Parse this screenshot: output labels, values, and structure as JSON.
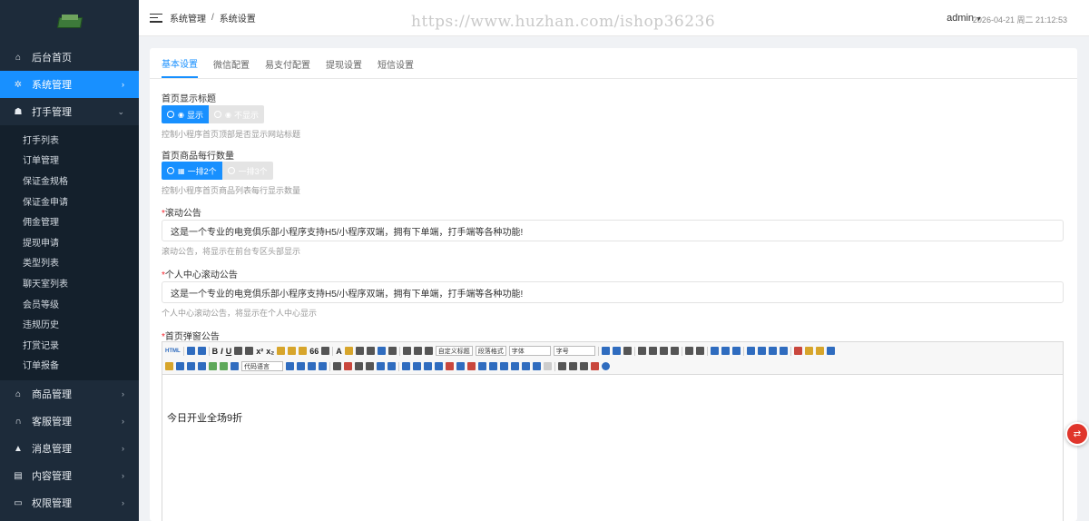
{
  "sidebar": {
    "items": [
      {
        "label": "后台首页",
        "icon": "home-icon"
      },
      {
        "label": "系统管理",
        "icon": "gear-icon",
        "active": true
      },
      {
        "label": "打手管理",
        "icon": "users-icon",
        "expanded": true
      },
      {
        "label": "商品管理",
        "icon": "bank-icon"
      },
      {
        "label": "客服管理",
        "icon": "headset-icon"
      },
      {
        "label": "消息管理",
        "icon": "bell-icon"
      },
      {
        "label": "内容管理",
        "icon": "file-icon"
      },
      {
        "label": "权限管理",
        "icon": "monitor-icon"
      }
    ],
    "sub_items": [
      "打手列表",
      "订单管理",
      "保证金规格",
      "保证金申请",
      "佣金管理",
      "提现申请",
      "类型列表",
      "聊天室列表",
      "会员等级",
      "违规历史",
      "打赏记录",
      "订单报备"
    ]
  },
  "header": {
    "breadcrumb": [
      "系统管理",
      "系统设置"
    ],
    "watermark": "https://www.huzhan.com/ishop36236",
    "user": "admin",
    "datetime": "2026-04-21 周二 21:12:53"
  },
  "tabs": [
    "基本设置",
    "微信配置",
    "易支付配置",
    "提现设置",
    "短信设置"
  ],
  "form": {
    "title_show": {
      "label": "首页显示标题",
      "on": "显示",
      "off": "不显示",
      "hint": "控制小程序首页顶部是否显示网站标题"
    },
    "per_row": {
      "label": "首页商品每行数量",
      "on": "一排2个",
      "off": "一排3个",
      "hint": "控制小程序首页商品列表每行显示数量"
    },
    "notice": {
      "label": "滚动公告",
      "value": "这是一个专业的电竞俱乐部小程序支持H5/小程序双端，拥有下单端，打手端等各种功能!",
      "hint": "滚动公告，将显示在前台专区头部显示"
    },
    "user_notice": {
      "label": "个人中心滚动公告",
      "value": "这是一个专业的电竞俱乐部小程序支持H5/小程序双端，拥有下单端，打手端等各种功能!",
      "hint": "个人中心滚动公告，将显示在个人中心显示"
    },
    "popup": {
      "label": "首页弹窗公告",
      "content": "今日开业全场9折"
    }
  },
  "editor": {
    "selects": [
      "自定义标题",
      "段落格式",
      "字体",
      "字号",
      "代码语言"
    ],
    "text_buttons": [
      "HTML",
      "B",
      "I",
      "U",
      "A",
      "x²",
      "x₂",
      "66",
      "A"
    ]
  },
  "colors": {
    "primary": "#1890ff",
    "sidebar": "#1d2b3a",
    "float": "#e0352b"
  }
}
